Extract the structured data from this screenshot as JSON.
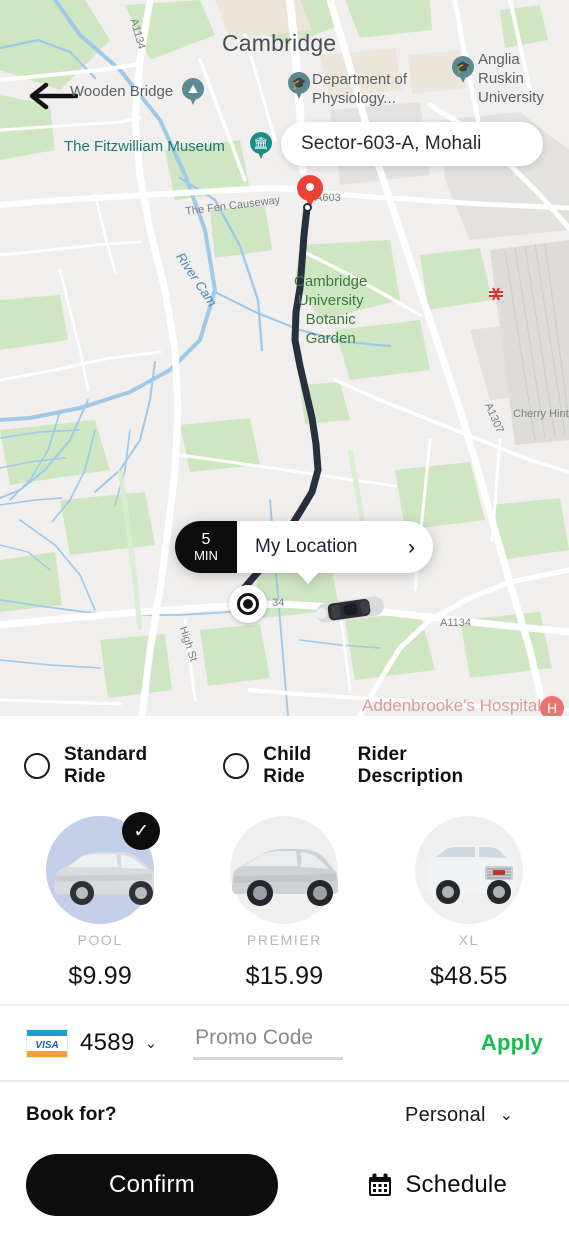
{
  "map": {
    "back_icon": "back-arrow-icon",
    "address_value": "Sector-603-A, Mohali",
    "city_label": "Cambridge",
    "labels": [
      {
        "name": "wooden-bridge",
        "text": "Wooden Bridge"
      },
      {
        "name": "department-of-physiology",
        "text": "Department of\nPhysiology..."
      },
      {
        "name": "anglia-ruskin-university",
        "text": "Anglia Ruskin\nUniversity"
      },
      {
        "name": "fitzwilliam-museum",
        "text": "The Fitzwilliam Museum"
      },
      {
        "name": "fen-causeway",
        "text": "The Fen Causeway"
      },
      {
        "name": "river-cam",
        "text": "River Cam"
      },
      {
        "name": "botanic-garden",
        "text": "Cambridge\nUniversity\nBotanic\nGarden"
      },
      {
        "name": "addenbrookes-hospital",
        "text": "Addenbrooke's Hospital"
      }
    ],
    "road_labels": [
      "A1134",
      "A603",
      "A1307",
      "Cherry Hint",
      "A1134",
      "High St",
      "34"
    ],
    "callout": {
      "eta_value": "5",
      "eta_unit": "MIN",
      "location_label": "My Location",
      "chevron": "›"
    }
  },
  "sheet": {
    "ride_types": [
      {
        "label": "Standard Ride",
        "selected": false
      },
      {
        "label": "Child Ride",
        "selected": false
      }
    ],
    "rider_description_label": "Rider Description",
    "vehicles": [
      {
        "name": "POOL",
        "price": "$9.99",
        "selected": true
      },
      {
        "name": "PREMIER",
        "price": "$15.99",
        "selected": false
      },
      {
        "name": "XL",
        "price": "$48.55",
        "selected": false
      }
    ],
    "payment": {
      "card_brand": "VISA",
      "card_last4": "4589",
      "chevron": "⌄",
      "promo_placeholder": "Promo Code",
      "promo_value": "",
      "apply_label": "Apply",
      "apply_color": "#13bf4b"
    },
    "book_for": {
      "label": "Book for?",
      "value": "Personal",
      "chevron": "⌄"
    },
    "actions": {
      "confirm_label": "Confirm",
      "schedule_label": "Schedule",
      "schedule_icon": "calendar-icon"
    }
  }
}
